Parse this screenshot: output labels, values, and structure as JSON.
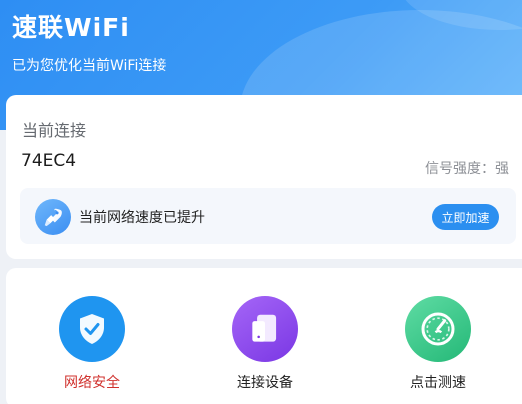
{
  "header": {
    "title": "速联WiFi",
    "subtitle": "已为您优化当前WiFi连接"
  },
  "connection": {
    "label": "当前连接",
    "ssid": "74EC4",
    "signal": "信号强度：强"
  },
  "boost": {
    "icon": "rocket-icon",
    "text": "当前网络速度已提升",
    "button_label": "立即加速"
  },
  "tools": [
    {
      "label": "网络安全",
      "icon": "shield-check-icon",
      "label_color": "#d0312d"
    },
    {
      "label": "连接设备",
      "icon": "devices-icon",
      "label_color": "#222222"
    },
    {
      "label": "点击测速",
      "icon": "speedometer-icon",
      "label_color": "#222222"
    }
  ],
  "colors": {
    "brand": "#2e8ef3",
    "shield": "#1f95f0",
    "devices": "#8a48e8",
    "speed": "#3ccf8c"
  }
}
